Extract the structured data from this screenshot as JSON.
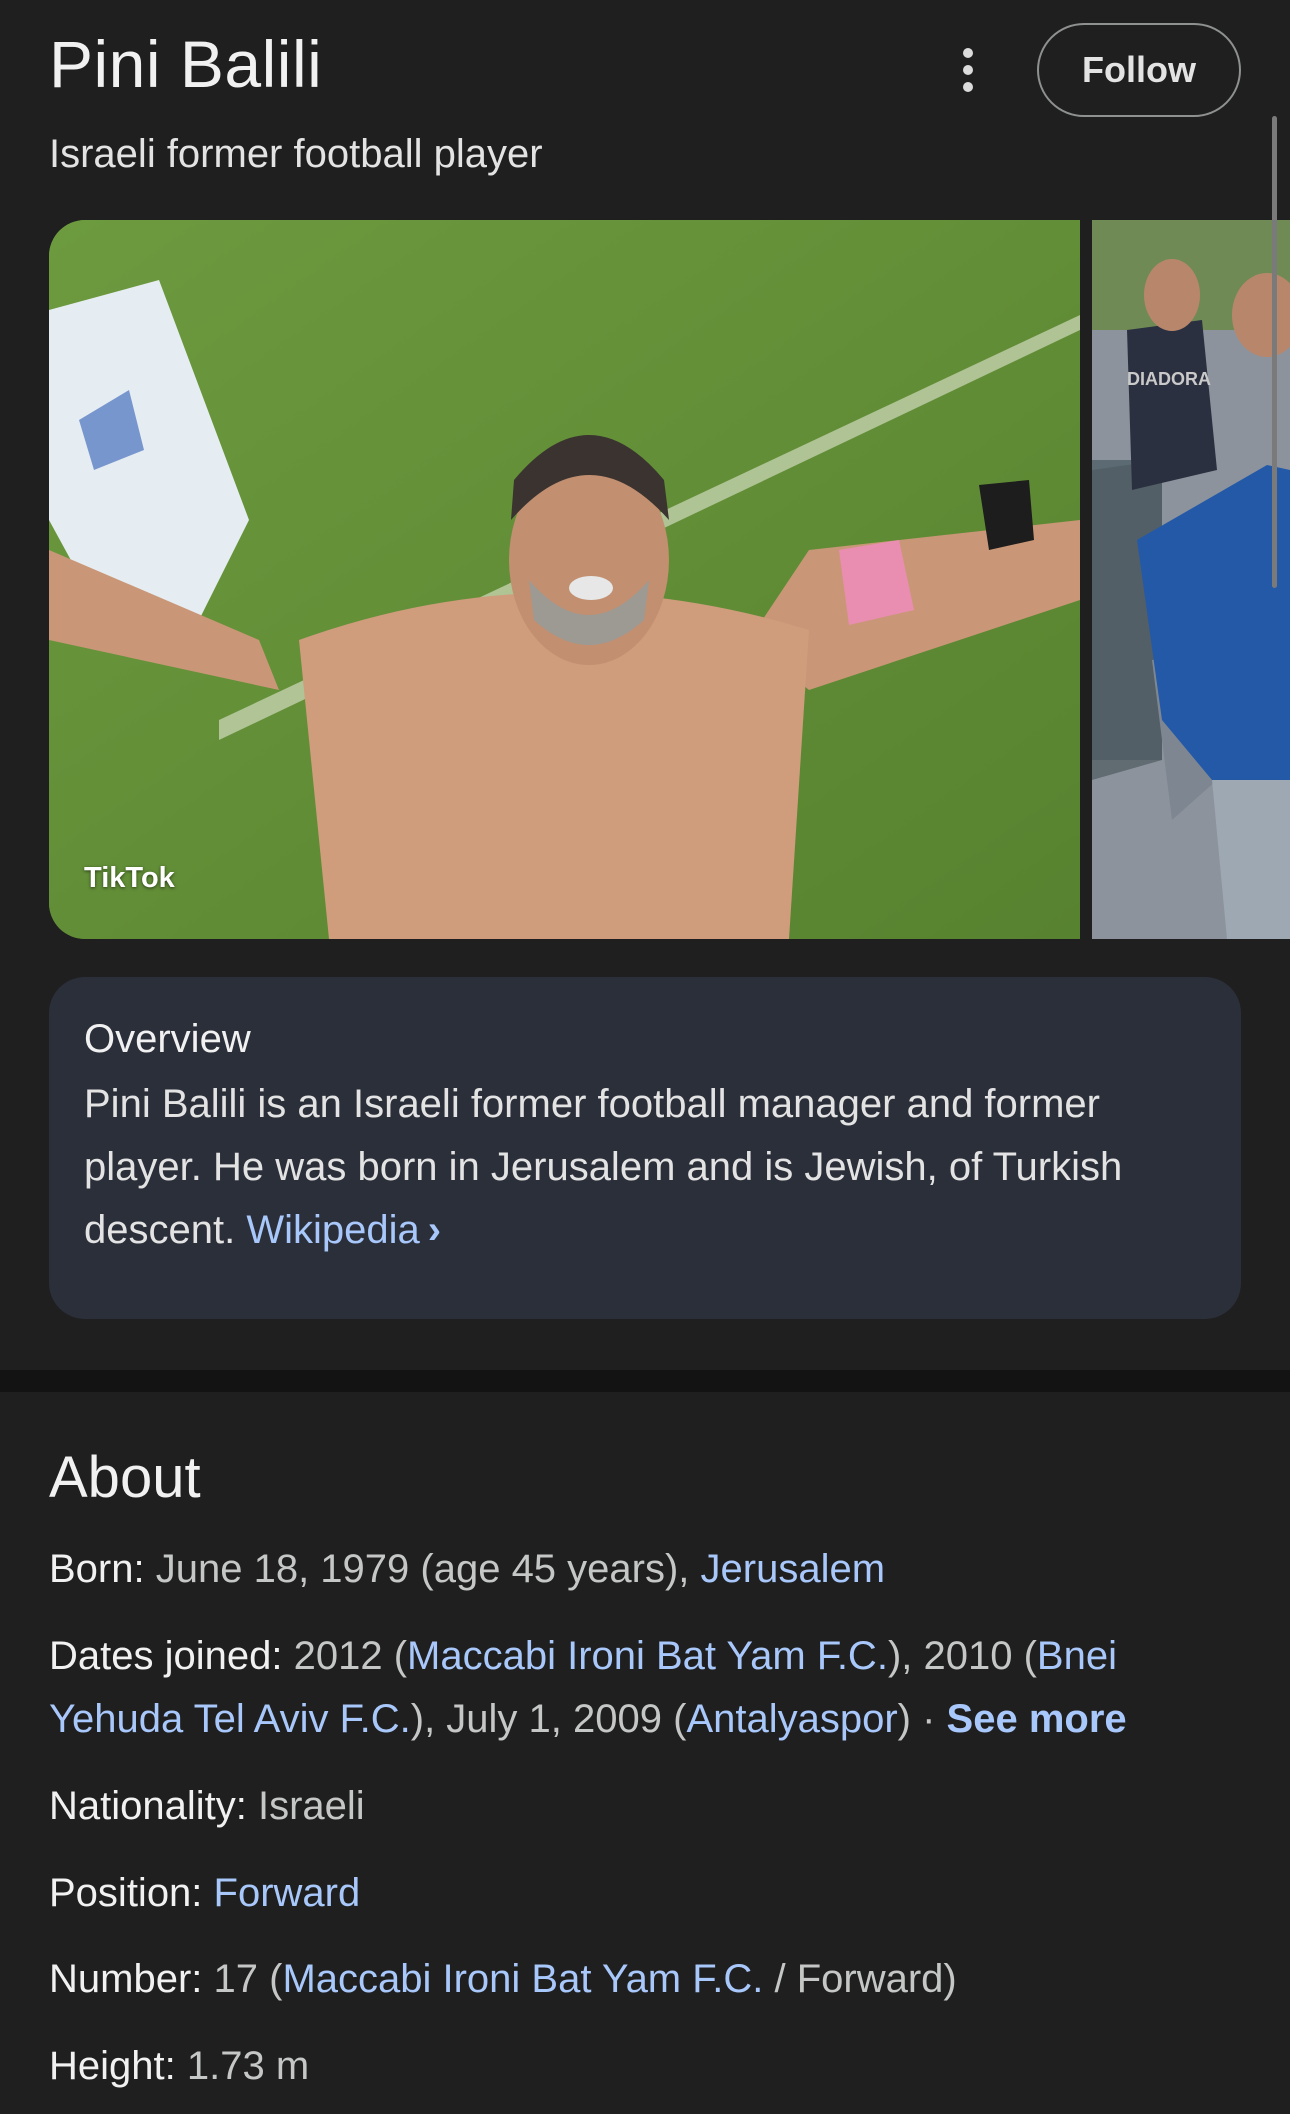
{
  "header": {
    "title": "Pini Balili",
    "subtitle": "Israeli former football player",
    "follow_label": "Follow"
  },
  "images": {
    "main_credit": "TikTok",
    "second_shirt_text": "DIADORA"
  },
  "overview": {
    "title": "Overview",
    "text": "Pini Balili is an Israeli former football manager and former player. He was born in Jerusalem and is Jewish, of Turkish descent. ",
    "source_link": "Wikipedia",
    "chevron": "›"
  },
  "about": {
    "title": "About",
    "born": {
      "label": "Born:",
      "value": " June 18, 1979 (age 45 years), ",
      "link": "Jerusalem"
    },
    "dates_joined": {
      "label": "Dates joined:",
      "part1": " 2012 (",
      "link1": "Maccabi Ironi Bat Yam F.C.",
      "part2": "), 2010 (",
      "link2": "Bnei Yehuda Tel Aviv F.C.",
      "part3": "), July 1, 2009 (",
      "link3": "Antalyaspor",
      "part4": ")",
      "separator": " · ",
      "see_more": "See more"
    },
    "nationality": {
      "label": "Nationality:",
      "value": " Israeli"
    },
    "position": {
      "label": "Position:",
      "link": "Forward"
    },
    "number": {
      "label": "Number:",
      "part1": " 17 (",
      "link": "Maccabi Ironi Bat Yam F.C.",
      "part2": " / Forward)"
    },
    "height": {
      "label": "Height:",
      "value": " 1.73 m"
    }
  },
  "colors": {
    "background": "#1f1f1f",
    "card": "#2b2f3a",
    "link": "#a8c7fa",
    "text": "#e3e3e3"
  }
}
